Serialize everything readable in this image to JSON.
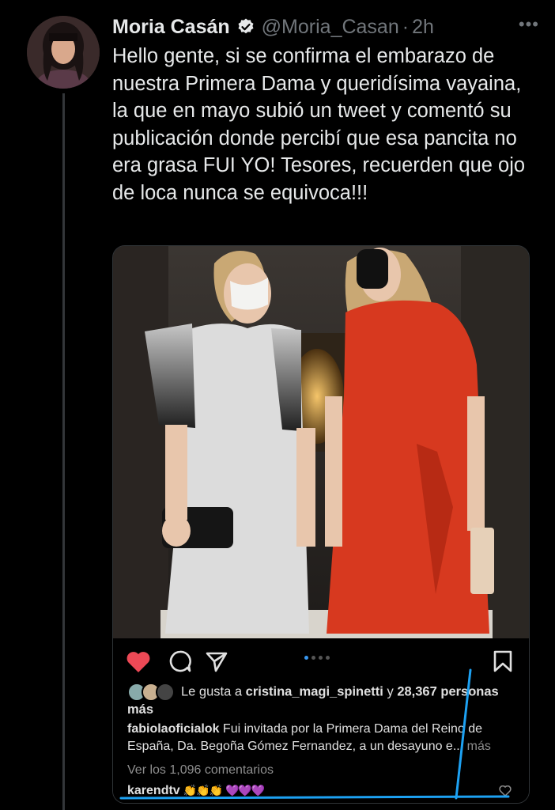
{
  "tweet": {
    "author_name": "Moria Casán",
    "handle": "@Moria_Casan",
    "separator": "·",
    "time": "2h",
    "more_label": "•••",
    "text": "Hello gente, si se confirma el embarazo de nuestra Primera Dama y queridísima vayaina, la que en mayo subió un tweet y comentó su publicación donde percibí que esa pancita no era grasa FUI YO! Tesores, recuerden que ojo de loca nunca se equivoca!!!"
  },
  "instagram": {
    "likes_prefix": "Le gusta a ",
    "likes_user": "cristina_magi_spinetti",
    "likes_middle": " y ",
    "likes_count": "28,367",
    "likes_suffix": " personas más",
    "caption_user": "fabiolaoficialok",
    "caption_text": " Fui invitada por la Primera Dama del Reino de España, Da. Begoña Gómez Fernandez, a un desayuno e...",
    "caption_more": " más",
    "comments_link": "Ver los 1,096 comentarios",
    "comment_user": "karendtv",
    "comment_emoji_yellow": "👏👏👏",
    "comment_emoji_purple": "💜💜💜"
  },
  "colors": {
    "background": "#000000",
    "text": "#e7e9ea",
    "muted": "#71767b",
    "verified": "#e7e9ea",
    "ig_heart": "#ed4956",
    "ig_blue": "#3897f0",
    "annotation_blue": "#1da1f2"
  },
  "icons": [
    "verified-badge-icon",
    "more-icon",
    "heart-icon",
    "comment-icon",
    "share-icon",
    "bookmark-icon",
    "small-heart-icon"
  ]
}
